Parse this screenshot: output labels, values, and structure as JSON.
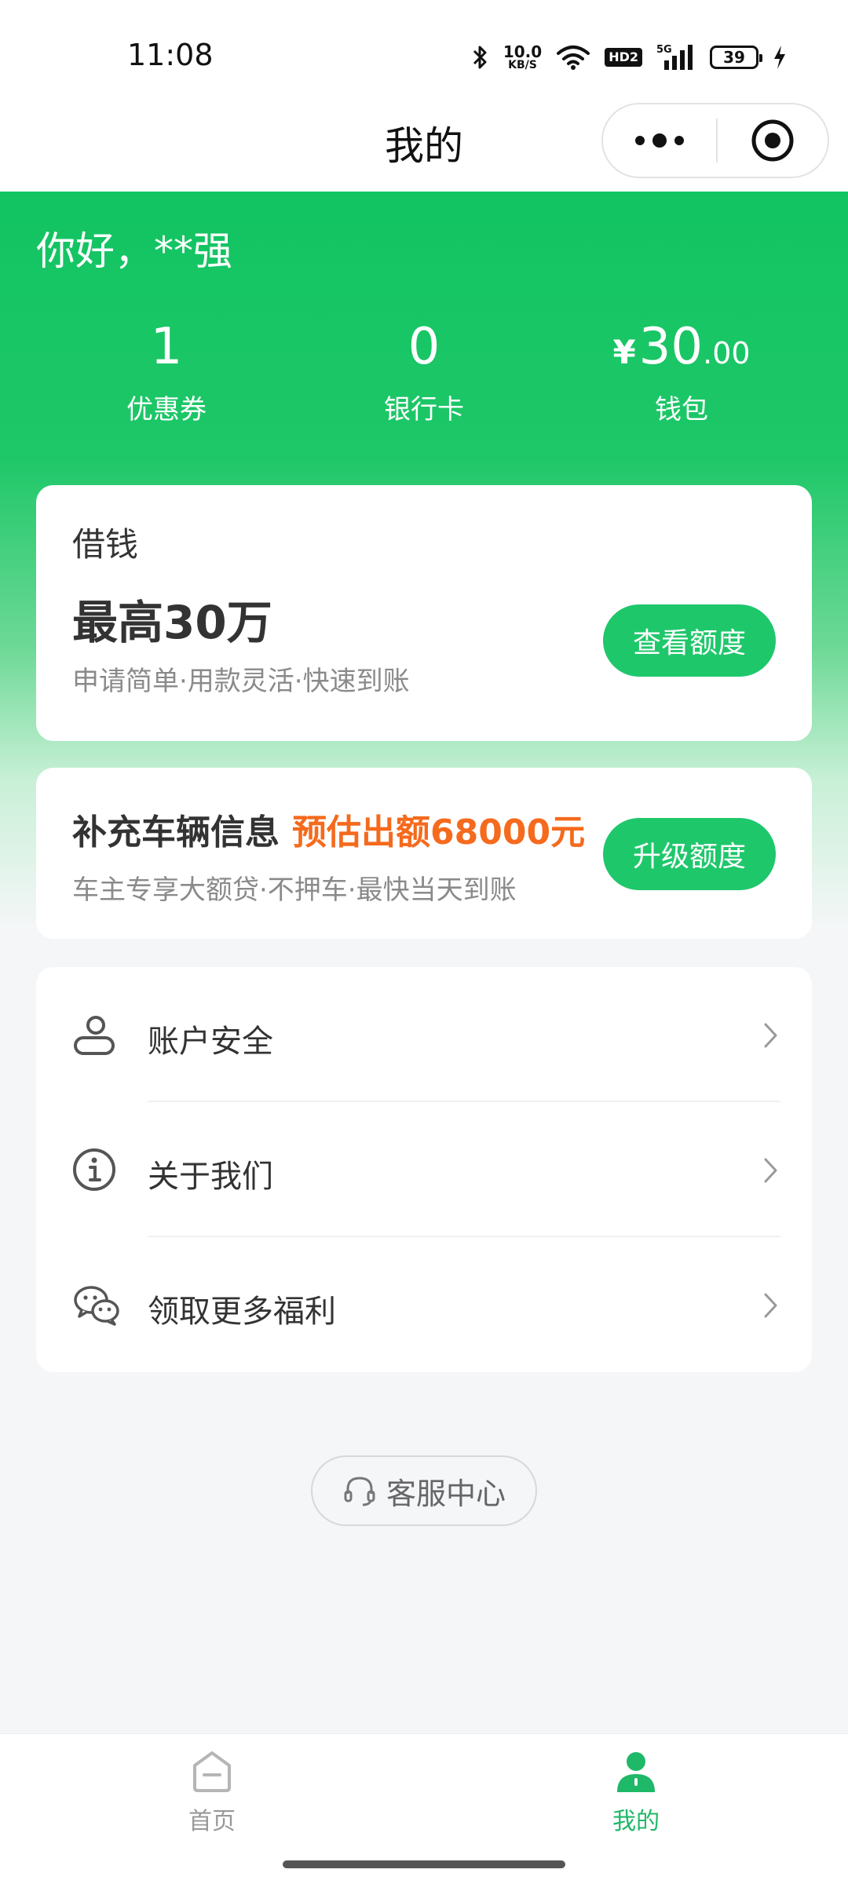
{
  "status_bar": {
    "time": "11:08",
    "net_speed_value": "10.0",
    "net_speed_unit": "KB/S",
    "hd_label": "HD2",
    "signal_label": "5G",
    "battery_level": "39"
  },
  "nav": {
    "title": "我的"
  },
  "user": {
    "greeting": "你好，**强"
  },
  "stats": [
    {
      "value": "1",
      "label": "优惠券"
    },
    {
      "value": "0",
      "label": "银行卡"
    },
    {
      "currency": "¥",
      "value": "30",
      "decimal": ".00",
      "label": "钱包"
    }
  ],
  "loan_card": {
    "title": "借钱",
    "amount": "最高30万",
    "description": "申请简单·用款灵活·快速到账",
    "button_label": "查看额度"
  },
  "vehicle_card": {
    "title": "补充车辆信息",
    "estimate": "预估出额68000元",
    "description": "车主专享大额贷·不押车·最快当天到账",
    "button_label": "升级额度"
  },
  "menu": [
    {
      "label": "账户安全",
      "icon": "person-icon"
    },
    {
      "label": "关于我们",
      "icon": "info-icon"
    },
    {
      "label": "领取更多福利",
      "icon": "wechat-icon"
    }
  ],
  "service": {
    "label": "客服中心"
  },
  "tabs": [
    {
      "label": "首页",
      "icon": "home-icon"
    },
    {
      "label": "我的",
      "icon": "user-icon"
    }
  ],
  "colors": {
    "brand_green": "#1fc76b",
    "accent_orange": "#f56a1d",
    "active_tab": "#1fb868",
    "inactive_tab": "#999999"
  }
}
